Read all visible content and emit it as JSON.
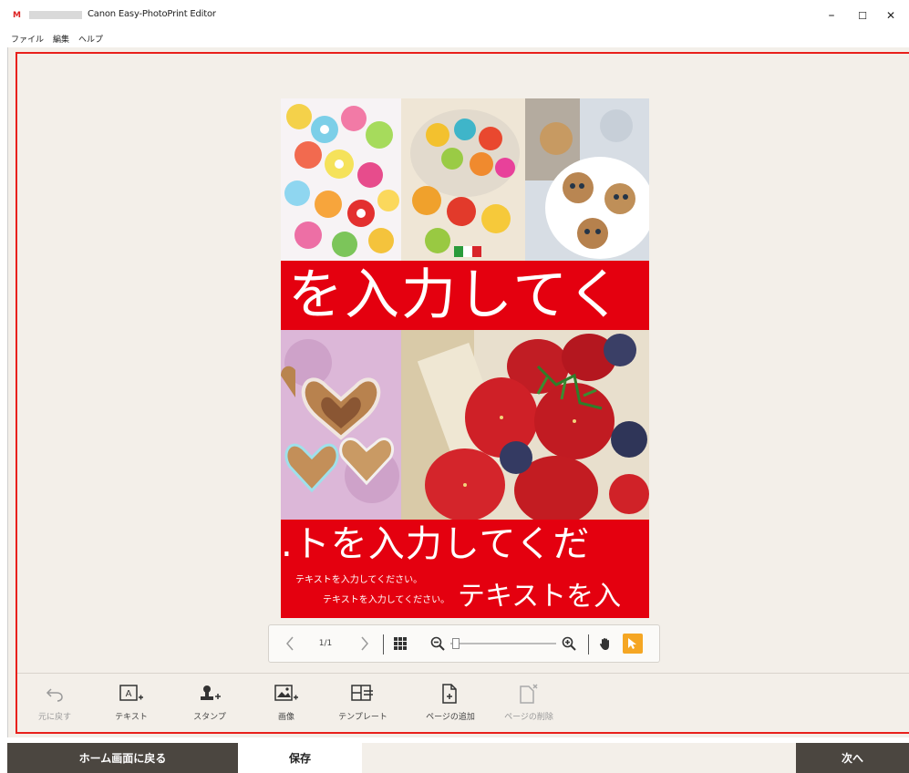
{
  "window": {
    "logo": "M",
    "title": "Canon Easy-PhotoPrint Editor",
    "minimize_glyph": "–",
    "maximize_glyph": "☐",
    "close_glyph": "✕"
  },
  "menu": [
    "ファイル",
    "編集",
    "ヘルプ"
  ],
  "canvas": {
    "banner1_text": "を入力してく",
    "banner2_big": ".トを入力してくだ",
    "banner2_small1": "テキストを入力してください。",
    "banner2_small2": "テキストを入力してください。",
    "banner2_big2": "テキストを入"
  },
  "navbar": {
    "page_indicator": "1/1"
  },
  "tools": [
    {
      "label": "元に戻す",
      "icon": "undo-icon",
      "enabled": false
    },
    {
      "label": "テキスト",
      "icon": "add-text-icon",
      "enabled": true
    },
    {
      "label": "スタンプ",
      "icon": "add-stamp-icon",
      "enabled": true
    },
    {
      "label": "画像",
      "icon": "add-image-icon",
      "enabled": true
    },
    {
      "label": "テンプレート",
      "icon": "template-icon",
      "enabled": true
    },
    {
      "label": "ページの追加",
      "icon": "add-page-icon",
      "enabled": true
    },
    {
      "label": "ページの削除",
      "icon": "delete-page-icon",
      "enabled": false
    }
  ],
  "footer": {
    "home_label": "ホーム画面に戻る",
    "save_label": "保存",
    "next_label": "次へ"
  },
  "colors": {
    "accent_red": "#e4000f",
    "frame_red": "#e8201b",
    "footer_dark": "#4b4640",
    "select_orange": "#f5a623"
  }
}
